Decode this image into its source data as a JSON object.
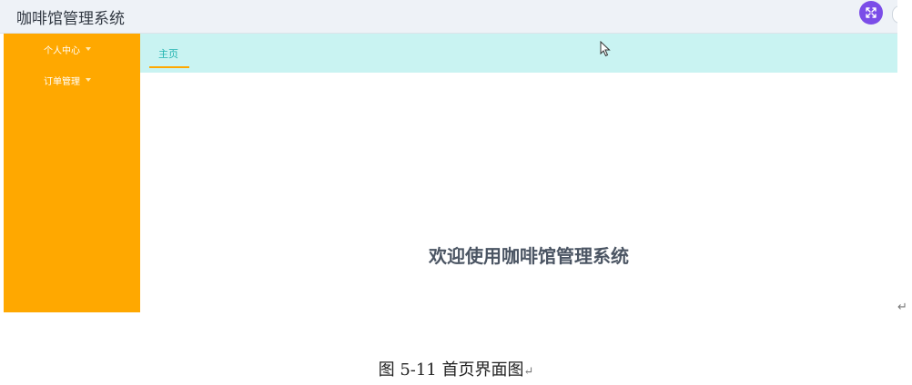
{
  "header": {
    "title": "咖啡馆管理系统",
    "fullscreen_icon": "expand-arrows-icon",
    "fullscreen_color": "#7b4de8"
  },
  "sidebar": {
    "background": "#ffa800",
    "items": [
      {
        "label": "个人中心",
        "icon": "caret-down-icon"
      },
      {
        "label": "订单管理",
        "icon": "caret-down-icon"
      }
    ]
  },
  "tabs": {
    "background": "#c9f3f2",
    "items": [
      {
        "label": "主页",
        "active": true
      }
    ]
  },
  "main": {
    "welcome": "欢迎使用咖啡馆管理系统"
  },
  "document": {
    "paragraph_mark": "↵",
    "caption": "图 5-11 首页界面图",
    "caption_mark": "↵"
  }
}
